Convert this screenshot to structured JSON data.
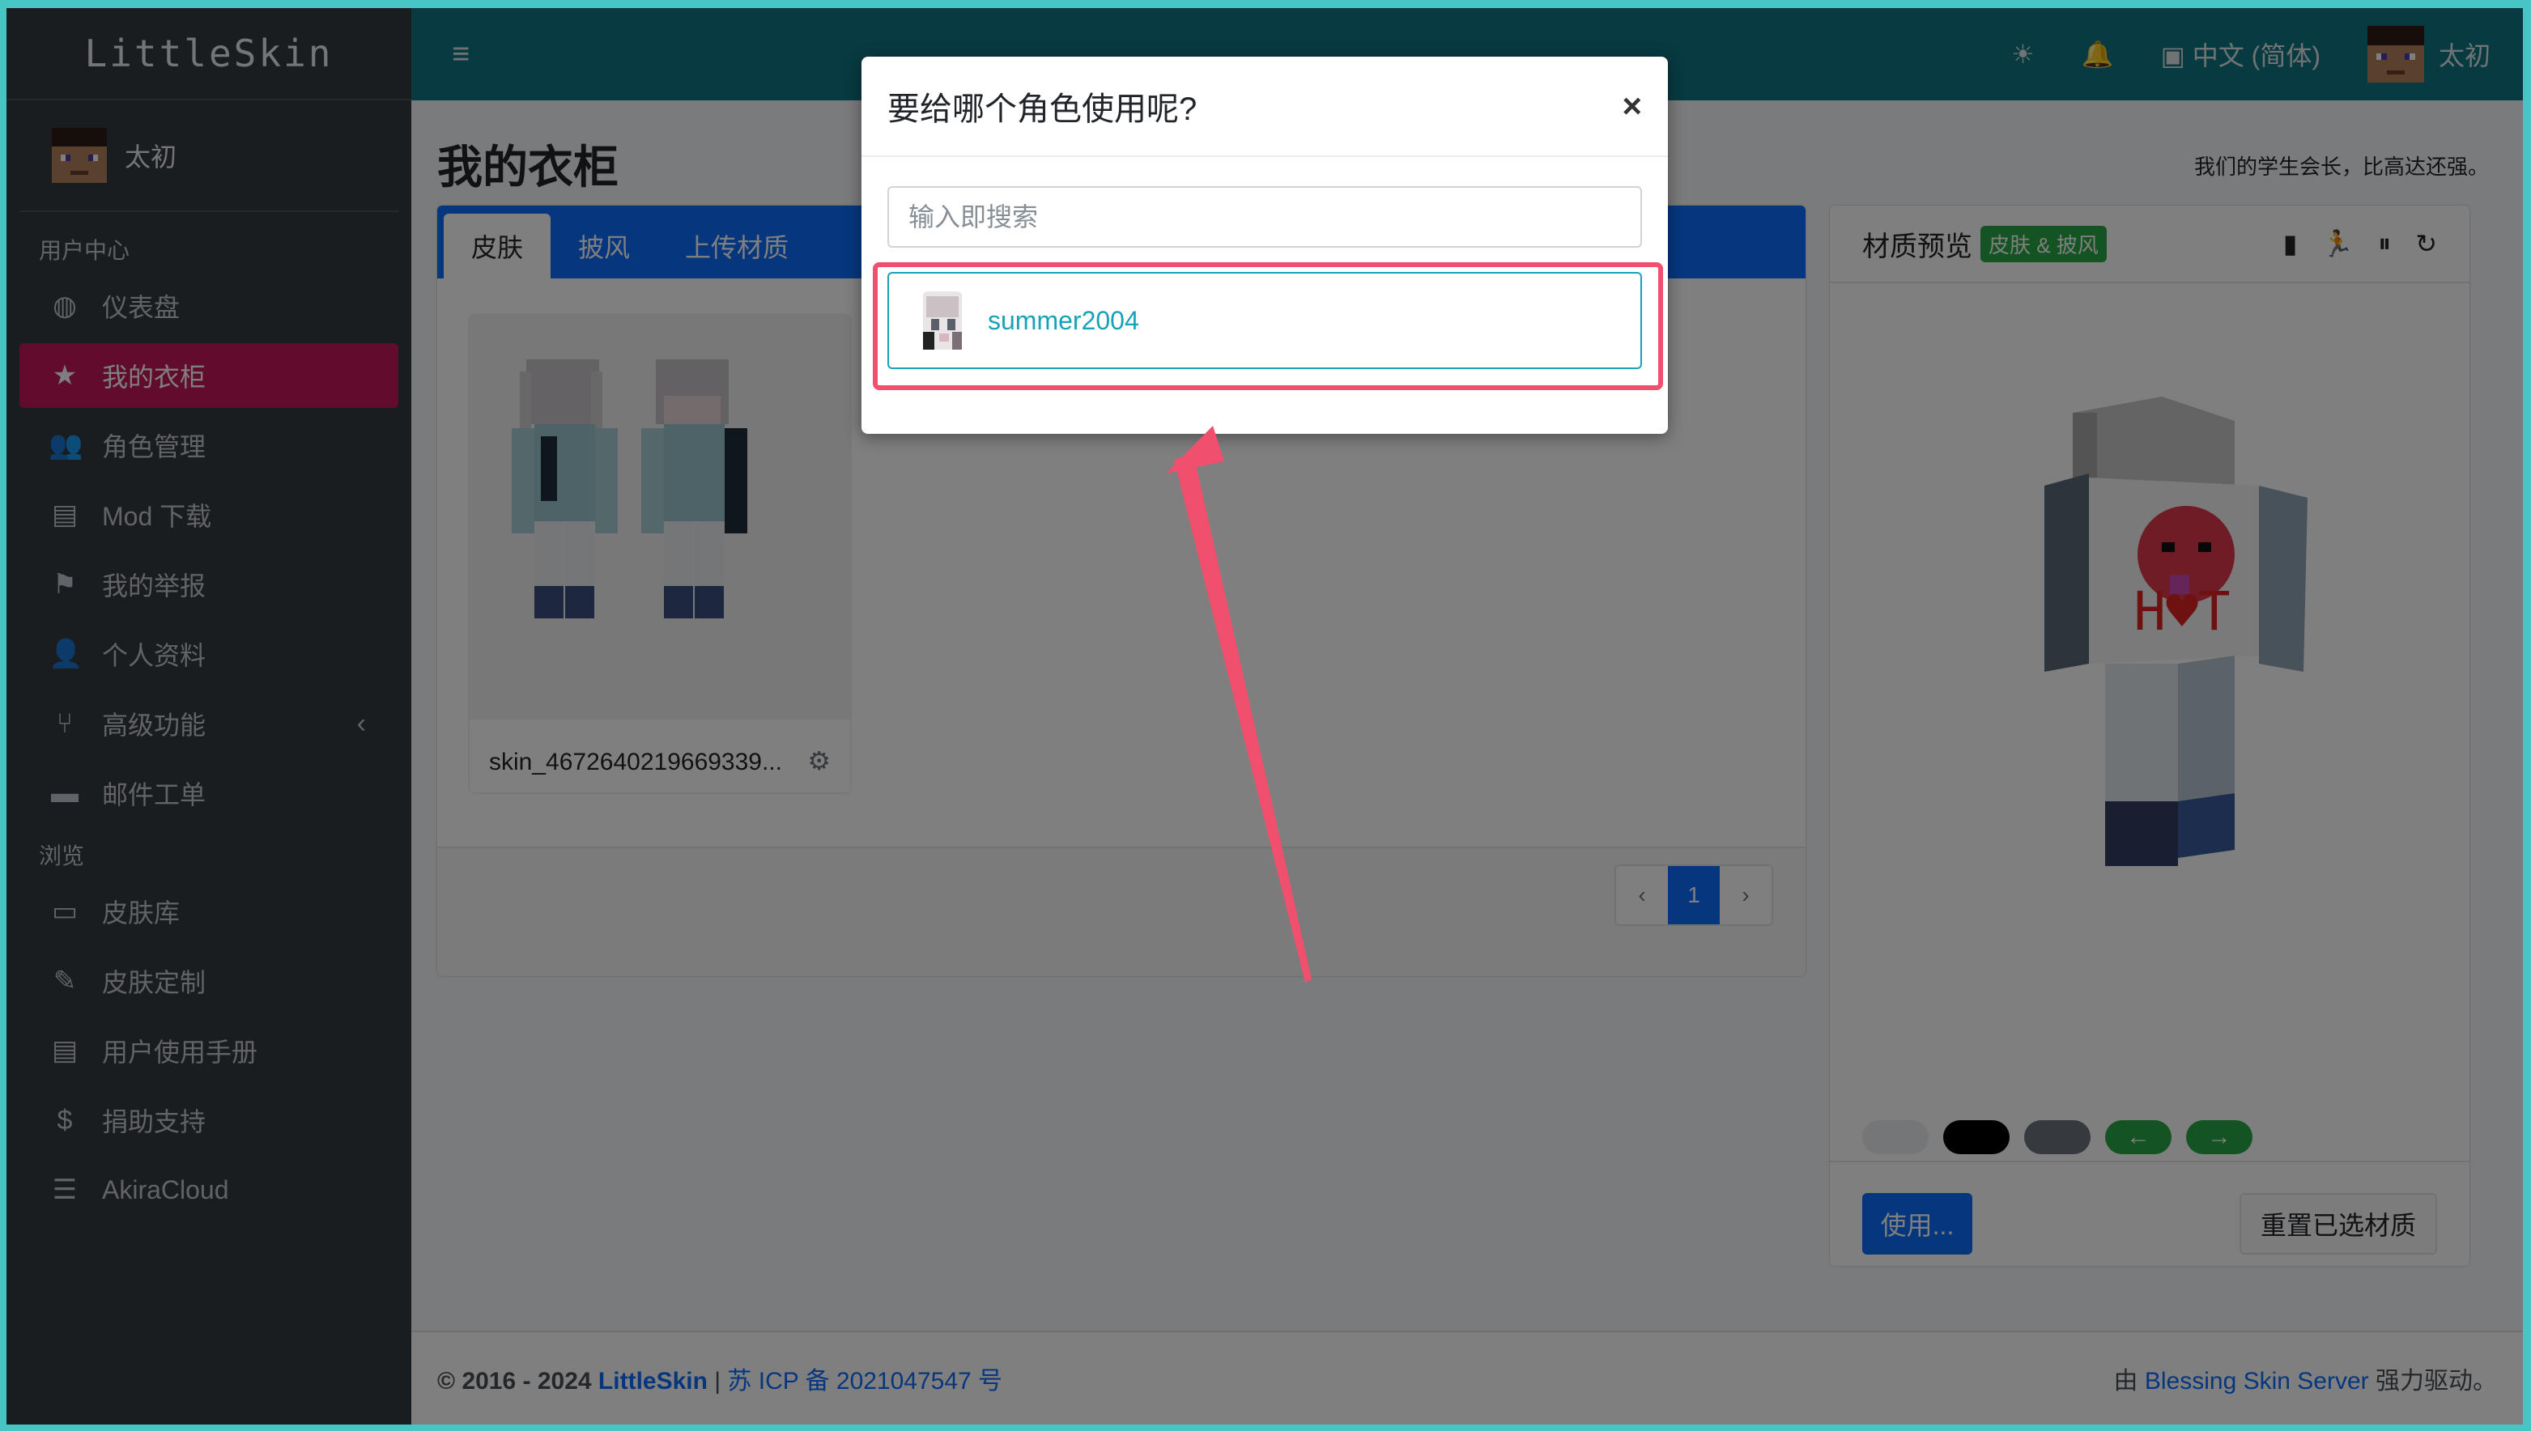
{
  "brand": "LittleSkin",
  "sidebar": {
    "user_name": "太初",
    "section_user": "用户中心",
    "section_browse": "浏览",
    "items_user": [
      {
        "label": "仪表盘",
        "icon": "dashboard-icon"
      },
      {
        "label": "我的衣柜",
        "icon": "star-icon"
      },
      {
        "label": "角色管理",
        "icon": "users-icon"
      },
      {
        "label": "Mod 下载",
        "icon": "book-icon"
      },
      {
        "label": "我的举报",
        "icon": "flag-icon"
      },
      {
        "label": "个人资料",
        "icon": "user-icon"
      },
      {
        "label": "高级功能",
        "icon": "branch-icon"
      },
      {
        "label": "邮件工单",
        "icon": "ticket-icon"
      }
    ],
    "items_browse": [
      {
        "label": "皮肤库",
        "icon": "archive-icon"
      },
      {
        "label": "皮肤定制",
        "icon": "pencil-icon"
      },
      {
        "label": "用户使用手册",
        "icon": "book-icon"
      },
      {
        "label": "捐助支持",
        "icon": "donate-icon"
      },
      {
        "label": "AkiraCloud",
        "icon": "server-icon"
      }
    ]
  },
  "topbar": {
    "language": "中文 (简体)",
    "user_name": "太初"
  },
  "page": {
    "title": "我的衣柜",
    "motto": "我们的学生会长，比高达还强。"
  },
  "closet": {
    "tabs": [
      "皮肤",
      "披风",
      "上传材质"
    ],
    "skin_name": "skin_4672640219669339...",
    "pages": [
      "‹",
      "1",
      "›"
    ]
  },
  "preview": {
    "title": "材质预览",
    "badge": "皮肤 & 披风",
    "use_button": "使用...",
    "reset_button": "重置已选材质",
    "bg_buttons": [
      "",
      "",
      "",
      "←",
      "→"
    ],
    "colors": {
      "light": "#e9ecef",
      "dark": "#000000",
      "gray": "#6c757d",
      "green": "#28a745"
    }
  },
  "footer": {
    "copyright": "© 2016 - 2024",
    "site": "LittleSkin",
    "sep": " | ",
    "icp": "苏 ICP 备 2021047547 号",
    "powered_prefix": "由",
    "powered_link": "Blessing Skin Server",
    "powered_suffix": "强力驱动。"
  },
  "modal": {
    "title": "要给哪个角色使用呢?",
    "close": "×",
    "search_placeholder": "输入即搜索",
    "player": "summer2004"
  },
  "annotation": {
    "color": "#f0506e"
  }
}
